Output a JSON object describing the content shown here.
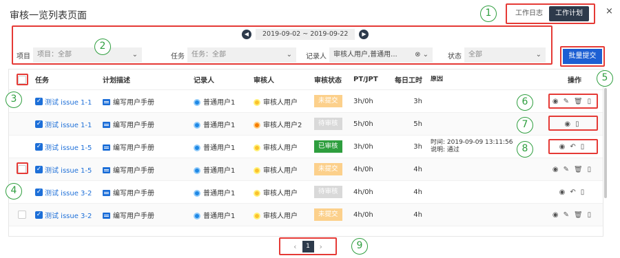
{
  "page": {
    "title": "审核一览列表页面"
  },
  "view_toggle": {
    "log": "工作日志",
    "plan": "工作计划"
  },
  "close": "×",
  "daterange": {
    "prev": "◀",
    "text": "2019-09-02 ~ 2019-09-22",
    "next": "▶"
  },
  "filters": {
    "project_label": "项目",
    "project_value": "项目：全部",
    "task_label": "任务",
    "task_value": "任务：全部",
    "recorder_label": "记录人",
    "recorder_value": "审核人用户,普通用...",
    "status_label": "状态",
    "status_value": "全部"
  },
  "batch_submit": "批量提交",
  "table": {
    "headers": [
      "任务",
      "计划描述",
      "记录人",
      "审核人",
      "审核状态",
      "PT/JPT",
      "每日工时",
      "原因",
      "操作"
    ],
    "rows": [
      {
        "task": "测试 issue 1-1",
        "desc": "编写用户手册",
        "recorder": "普通用户1",
        "reviewer": "审核人用户",
        "status": "未提交",
        "ptjpt": "3h/0h",
        "daily": "3h",
        "reason": "",
        "ops": [
          "view-icon",
          "edit-icon",
          "delete-icon",
          "file-icon"
        ]
      },
      {
        "task": "测试 issue 1-1",
        "desc": "编写用户手册",
        "recorder": "普通用户1",
        "reviewer": "审核人用户2",
        "status": "待审核",
        "ptjpt": "5h/0h",
        "daily": "5h",
        "reason": "",
        "ops": [
          "view-icon",
          "file-icon"
        ]
      },
      {
        "task": "测试 issue 1-5",
        "desc": "编写用户手册",
        "recorder": "普通用户1",
        "reviewer": "审核人用户",
        "status": "已审核",
        "ptjpt": "3h/0h",
        "daily": "3h",
        "reason": "时间: 2019-09-09 13:11:56",
        "reason2": "说明: 通过",
        "ops": [
          "view-icon",
          "undo-icon",
          "file-icon"
        ]
      },
      {
        "task": "测试 issue 1-5",
        "desc": "编写用户手册",
        "recorder": "普通用户1",
        "reviewer": "审核人用户",
        "status": "未提交",
        "ptjpt": "4h/0h",
        "daily": "4h",
        "reason": "",
        "ops": [
          "view-icon",
          "edit-icon",
          "delete-icon",
          "file-icon"
        ]
      },
      {
        "task": "测试 issue 3-2",
        "desc": "编写用户手册",
        "recorder": "普通用户1",
        "reviewer": "审核人用户",
        "status": "待审核",
        "ptjpt": "4h/0h",
        "daily": "4h",
        "reason": "",
        "ops": [
          "view-icon",
          "undo-icon",
          "file-icon"
        ]
      },
      {
        "task": "测试 issue 3-2",
        "desc": "编写用户手册",
        "recorder": "普通用户1",
        "reviewer": "审核人用户",
        "status": "未提交",
        "ptjpt": "4h/0h",
        "daily": "4h",
        "reason": "",
        "ops": [
          "view-icon",
          "edit-icon",
          "delete-icon",
          "file-icon"
        ]
      }
    ]
  },
  "pager": {
    "prev": "‹",
    "page": "1",
    "next": "›"
  },
  "callouts": [
    "1",
    "2",
    "3",
    "4",
    "5",
    "6",
    "7",
    "8",
    "9"
  ],
  "colors": {
    "primary": "#1d5fd3",
    "dark": "#2d3a4b",
    "annotation_red": "#e53935",
    "annotation_green": "#2e9e3e"
  }
}
